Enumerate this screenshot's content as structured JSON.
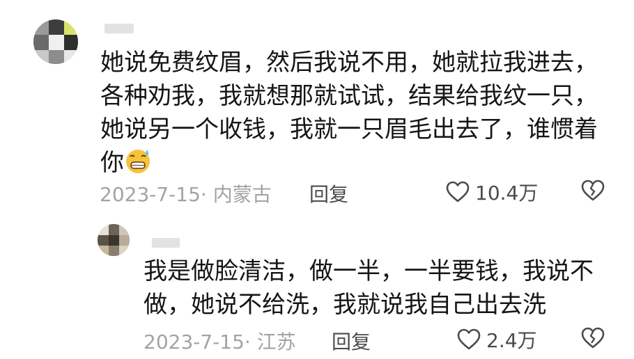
{
  "comments": [
    {
      "text": "她说免费纹眉，然后我说不用，她就拉我进去，各种劝我，我就想那就试试，结果给我纹一只，她说另一个收钱，我就一只眉毛出去了，谁惯着你",
      "emoji": "sweat-grin-emoji",
      "date_location": "2023-7-15· 内蒙古",
      "reply_label": "回复",
      "likes": "10.4万"
    },
    {
      "text": "我是做脸清洁，做一半，一半要钱，我说不做，她说不给洗，我就说我自己出去洗",
      "date_location": "2023-7-15· 江苏",
      "reply_label": "回复",
      "likes": "2.4万"
    }
  ],
  "icons": {
    "like": "heart-outline-icon",
    "dislike": "broken-heart-icon"
  },
  "colors": {
    "text": "#151515",
    "meta": "#a3a3a3",
    "action": "#4b4b4b",
    "background": "#ffffff"
  }
}
